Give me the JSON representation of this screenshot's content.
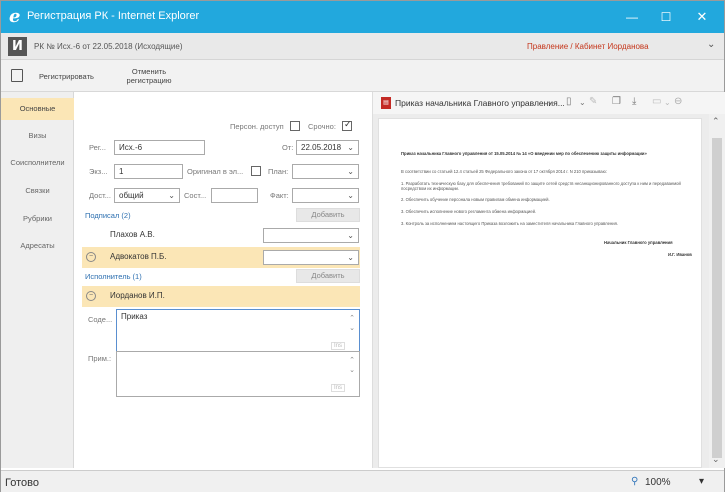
{
  "window": {
    "title": "Регистрация РК - Internet Explorer",
    "logo_glyph": "e",
    "minimize": "—",
    "maximize": "☐",
    "close": "✕"
  },
  "appbar": {
    "logo": "И",
    "doc_title": "РК № Исх.-6 от 22.05.2018 (Исходящие)",
    "user_link": "Правление / Кабинет Иорданова"
  },
  "toolbar": {
    "register_label": "Регистрировать",
    "cancel_label_1": "Отменить",
    "cancel_label_2": "регистрацию"
  },
  "sidebar": {
    "items": [
      {
        "label": "Основные",
        "active": true
      },
      {
        "label": "Визы"
      },
      {
        "label": "Соисполнители"
      },
      {
        "label": "Связки"
      },
      {
        "label": "Рубрики"
      },
      {
        "label": "Адресаты"
      }
    ]
  },
  "form": {
    "personal_access_label": "Персон. доступ",
    "urgent_label": "Срочно:",
    "reg_label": "Рег...",
    "reg_value": "Исх.-6",
    "from_label": "От:",
    "from_value": "22.05.2018",
    "copies_label": "Экз...",
    "copies_value": "1",
    "original_label": "Оригинал в эл...",
    "plan_label": "План:",
    "access_label": "Дост...",
    "access_value": "общий",
    "status_label": "Сост...",
    "fact_label": "Факт:",
    "signed_label": "Подписал (2)",
    "add_label_1": "Добавить",
    "signer_1": "Плахов А.В.",
    "signer_2": "Адвокатов П.Б.",
    "executor_label": "Исполнитель (1)",
    "add_label_2": "Добавить",
    "executor_1": "Иорданов И.П.",
    "content_label": "Соде...",
    "content_value": "Приказ",
    "note_label": "Прим.:",
    "ta_btn": "Ins"
  },
  "viewer": {
    "title": "Приказ начальника Главного управления...",
    "doc_heading": "Приказ начальника Главного управления от 15.05.2014 № 14 «О введении мер по обеспечению защиты информации»",
    "line1": "В соответствии со статьей 12.4 статьей 25 Федерального закона от 17 октября 2014 г. N 210 приказываю:",
    "line2": "1. Разработать техническую базу для обеспечения требований по защите сетей средств несанкционированного доступа к ним и передаваемой посредством их информации.",
    "line3": "2. Обеспечить обучение персонала новым правилам обмена информацией.",
    "line4": "3. Обеспечить исполнение нового регламента обмена информацией.",
    "line5": "3. Контроль за исполнением настоящего Приказа возложить на заместителя начальника Главного управления.",
    "sign_title": "Начальник Главного управления",
    "sign_name": "И.Г. Иванов"
  },
  "status": {
    "text": "Готово",
    "zoom": "100%"
  }
}
